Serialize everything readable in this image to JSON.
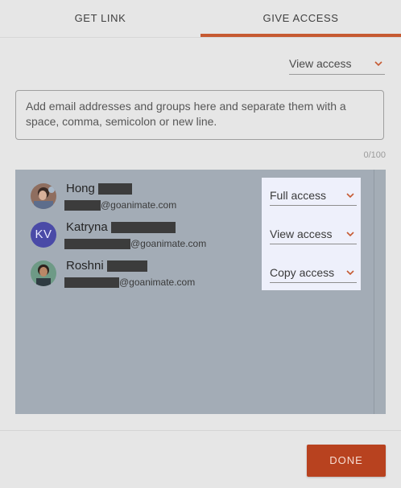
{
  "tabs": {
    "get_link": "GET LINK",
    "give_access": "GIVE ACCESS",
    "active": "give_access"
  },
  "default_access": {
    "value": "View access"
  },
  "invite": {
    "placeholder": "Add email addresses and groups here and separate them with a space, comma, semicolon or new line.",
    "counter": "0/100"
  },
  "users": [
    {
      "first_name": "Hong",
      "email_domain": "@goanimate.com",
      "access": "Full access",
      "avatar": "photo"
    },
    {
      "first_name": "Katryna",
      "email_domain": "@goanimate.com",
      "access": "View access",
      "avatar_initials": "KV"
    },
    {
      "first_name": "Roshni",
      "email_domain": "@goanimate.com",
      "access": "Copy access",
      "avatar": "photo"
    }
  ],
  "footer": {
    "done_label": "DONE"
  },
  "colors": {
    "accent": "#c65a32",
    "done_button": "#b8421f",
    "list_background": "#a3acb6",
    "highlight": "#eef0fb"
  }
}
